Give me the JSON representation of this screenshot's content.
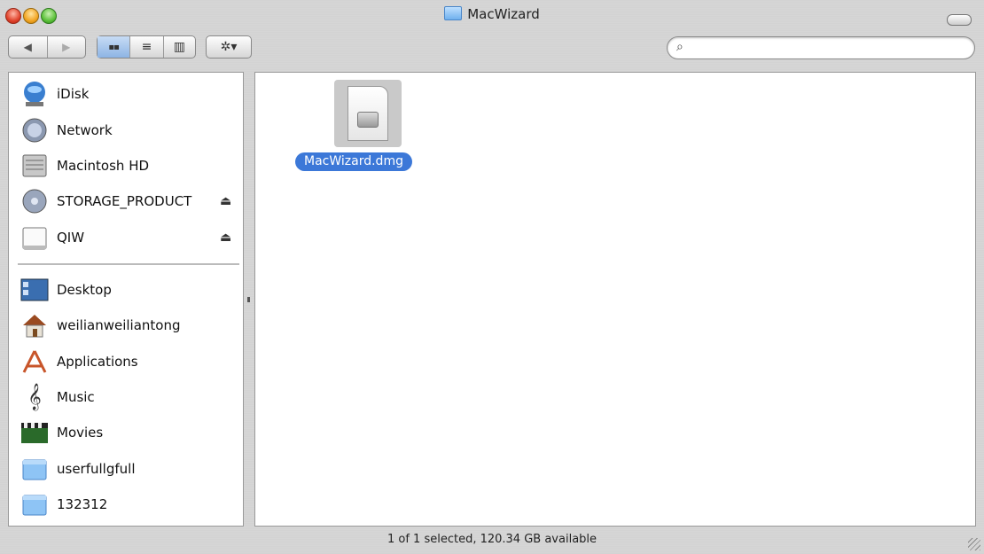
{
  "window": {
    "title": "MacWizard",
    "buttons": [
      "close",
      "minimize",
      "zoom"
    ]
  },
  "toolbar": {
    "back_icon": "back-arrow-icon",
    "forward_icon": "forward-arrow-icon",
    "view_buttons": [
      {
        "name": "icon-view",
        "glyph": "▪▪",
        "active": true
      },
      {
        "name": "list-view",
        "glyph": "≡",
        "active": false
      },
      {
        "name": "column-view",
        "glyph": "▥",
        "active": false
      }
    ],
    "action_glyph": "✲▾",
    "search": {
      "placeholder": "",
      "value": "",
      "icon_glyph": "🔍"
    }
  },
  "sidebar": {
    "devices": [
      {
        "label": "iDisk",
        "icon": "idisk-icon"
      },
      {
        "label": "Network",
        "icon": "network-globe-icon"
      },
      {
        "label": "Macintosh HD",
        "icon": "hard-drive-icon"
      },
      {
        "label": "STORAGE_PRODUCT",
        "icon": "storage-disc-icon",
        "eject": "⏏"
      },
      {
        "label": "QIW",
        "icon": "removable-drive-icon",
        "eject": "⏏"
      }
    ],
    "places": [
      {
        "label": "Desktop",
        "icon": "desktop-icon"
      },
      {
        "label": "weilianweiliantong",
        "icon": "home-icon"
      },
      {
        "label": "Applications",
        "icon": "applications-icon"
      },
      {
        "label": "Music",
        "icon": "music-icon"
      },
      {
        "label": "Movies",
        "icon": "movies-icon"
      },
      {
        "label": "userfullgfull",
        "icon": "folder-icon"
      },
      {
        "label": "132312",
        "icon": "folder-icon"
      }
    ]
  },
  "main": {
    "files": [
      {
        "name": "MacWizard.dmg",
        "icon": "dmg-file-icon",
        "selected": true
      }
    ]
  },
  "status": {
    "text": "1 of 1 selected, 120.34 GB available"
  },
  "colors": {
    "selection": "#3c78d8",
    "window_bg": "#d3d3d3"
  }
}
